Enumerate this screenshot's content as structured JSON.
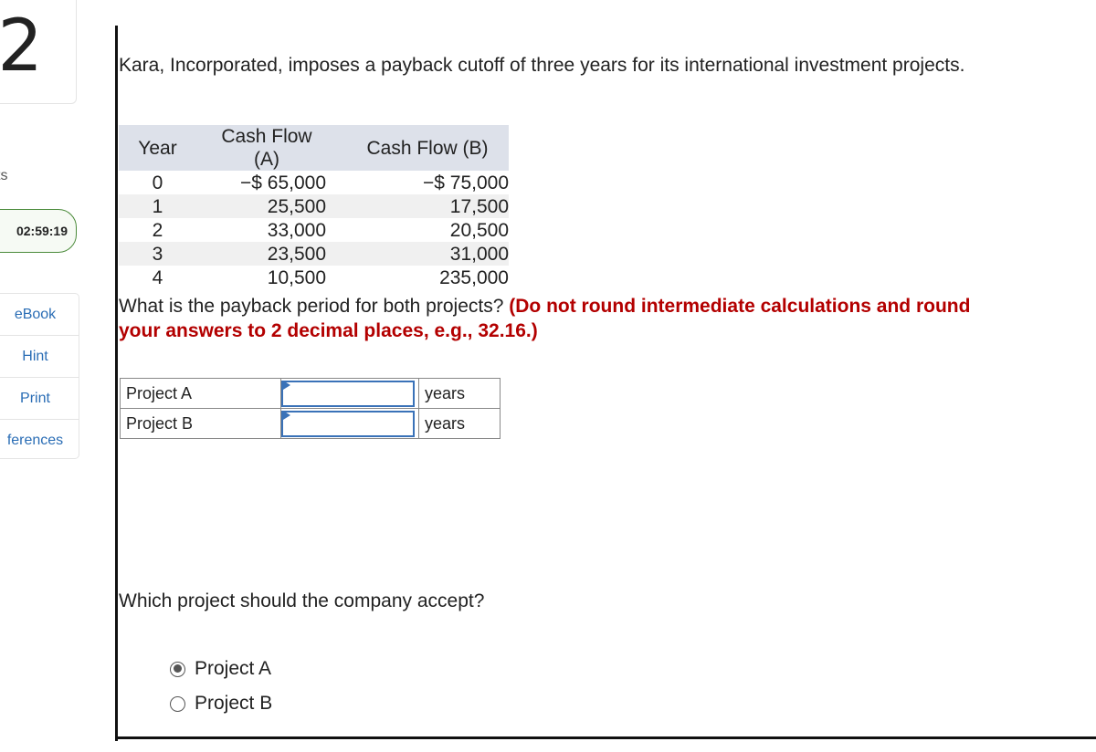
{
  "sidebar": {
    "question_number": "2",
    "points_label": "ts",
    "timer": "02:59:19",
    "tools": [
      "eBook",
      "Hint",
      "Print",
      "ferences"
    ]
  },
  "question": {
    "intro": "Kara, Incorporated, imposes a payback cutoff of three years for its international investment projects.",
    "table": {
      "headers": [
        "Year",
        "Cash Flow (A)",
        "Cash Flow (B)"
      ],
      "rows": [
        [
          "0",
          "−$ 65,000",
          "−$ 75,000"
        ],
        [
          "1",
          "25,500",
          "17,500"
        ],
        [
          "2",
          "33,000",
          "20,500"
        ],
        [
          "3",
          "23,500",
          "31,000"
        ],
        [
          "4",
          "10,500",
          "235,000"
        ]
      ]
    },
    "prompt": "What is the payback period for both projects?",
    "instruction": "(Do not round intermediate calculations and round your answers to 2 decimal places, e.g., 32.16.)",
    "answers": [
      {
        "label": "Project A",
        "value": "",
        "unit": "years"
      },
      {
        "label": "Project B",
        "value": "",
        "unit": "years"
      }
    ],
    "accept_prompt": "Which project should the company accept?",
    "options": [
      {
        "label": "Project A",
        "selected": true
      },
      {
        "label": "Project B",
        "selected": false
      }
    ]
  }
}
